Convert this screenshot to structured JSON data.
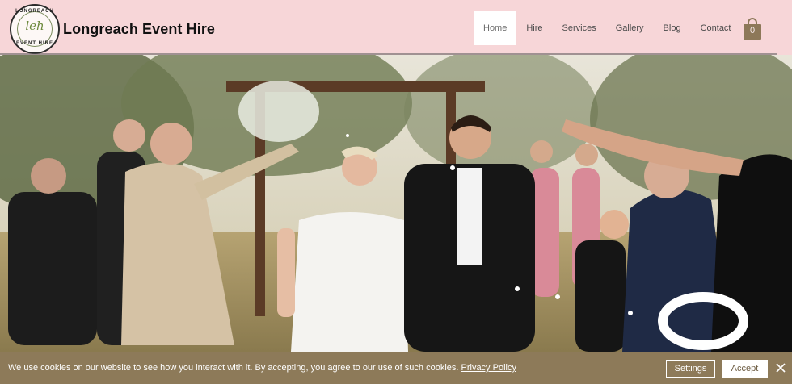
{
  "brand": {
    "name": "Longreach Event Hire",
    "logo_monogram": "leh",
    "logo_ring_top": "LONGREACH",
    "logo_ring_bottom": "EVENT HIRE"
  },
  "nav": {
    "items": [
      {
        "label": "Home",
        "active": true
      },
      {
        "label": "Hire"
      },
      {
        "label": "Services"
      },
      {
        "label": "Gallery"
      },
      {
        "label": "Blog"
      },
      {
        "label": "Contact"
      }
    ]
  },
  "cart": {
    "count": "0",
    "icon": "shopping-bag-icon"
  },
  "hero": {
    "icon": "wedding-photo"
  },
  "cookie_banner": {
    "message": "We use cookies on our website to see how you interact with it. By accepting, you agree to our use of such cookies.",
    "privacy_link": "Privacy Policy",
    "settings_label": "Settings",
    "accept_label": "Accept",
    "close_icon": "close-icon"
  },
  "colors": {
    "header_bg": "#f7d6d8",
    "accent_brown": "#8d7a59",
    "cart": "#8d7859"
  }
}
